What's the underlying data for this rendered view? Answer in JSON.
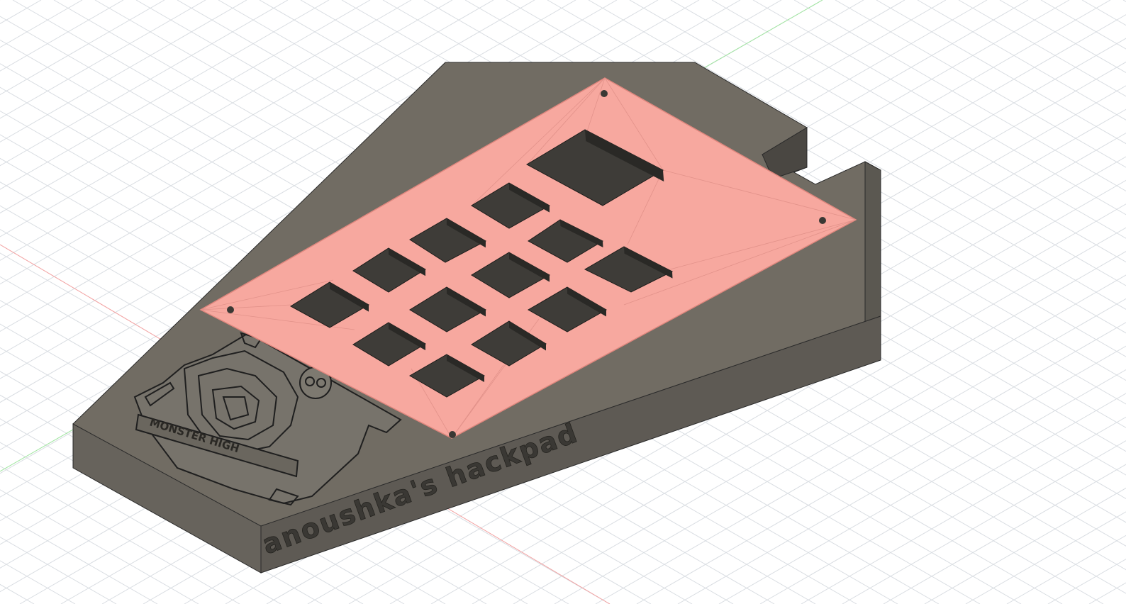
{
  "viewport": {
    "background": "#ffffff",
    "grid_color": "#d9dde2",
    "axis_x_color": "#f08a8a",
    "axis_y_color": "#8ee08e"
  },
  "model": {
    "body_top_color": "#716c63",
    "body_side_color": "#605c55",
    "body_front_color": "#58544e",
    "plate_color": "#f6a59c",
    "plate_edge_color": "#e28b82",
    "socket_color": "#3e3c38",
    "engraving_text": "anoushka's hackpad",
    "logo_text": "MONSTER HIGH"
  }
}
